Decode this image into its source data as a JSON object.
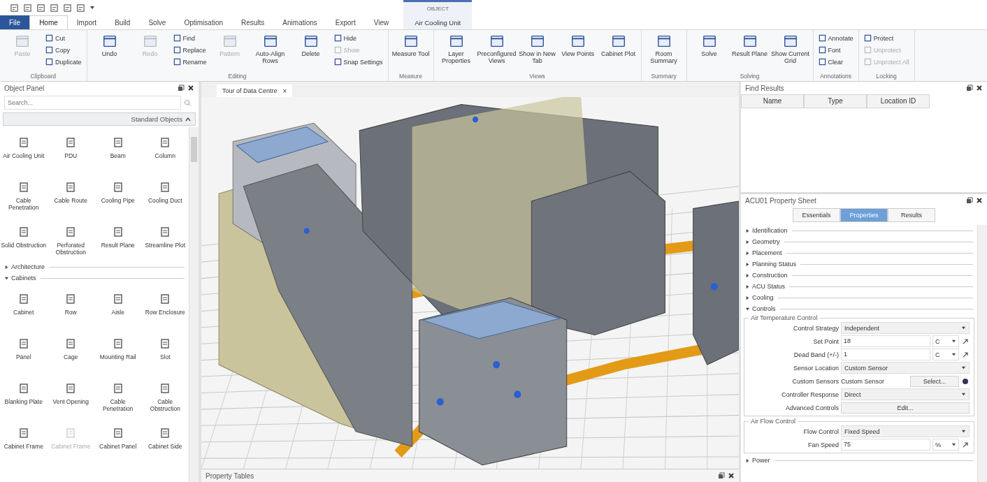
{
  "tabs": [
    {
      "label": "File",
      "kind": "file",
      "selected": false
    },
    {
      "label": "Home",
      "kind": "tab",
      "selected": true
    },
    {
      "label": "Import",
      "kind": "tab",
      "selected": false
    },
    {
      "label": "Build",
      "kind": "tab",
      "selected": false
    },
    {
      "label": "Solve",
      "kind": "tab",
      "selected": false
    },
    {
      "label": "Optimisation",
      "kind": "tab",
      "selected": false
    },
    {
      "label": "Results",
      "kind": "tab",
      "selected": false
    },
    {
      "label": "Animations",
      "kind": "tab",
      "selected": false
    },
    {
      "label": "Export",
      "kind": "tab",
      "selected": false
    },
    {
      "label": "View",
      "kind": "tab",
      "selected": false
    }
  ],
  "context_tab": {
    "group": "OBJECT",
    "label": "Air Cooling Unit",
    "selected": false
  },
  "ribbon": {
    "groups": [
      {
        "label": "Clipboard",
        "tools": [
          {
            "label": "Paste",
            "kind": "large",
            "disabled": true
          },
          {
            "label": "Cut",
            "kind": "small",
            "disabled": false
          },
          {
            "label": "Copy",
            "kind": "small",
            "disabled": false
          },
          {
            "label": "Duplicate",
            "kind": "small",
            "disabled": false
          }
        ]
      },
      {
        "label": "Editing",
        "tools": [
          {
            "label": "Undo",
            "kind": "large",
            "disabled": false
          },
          {
            "label": "Redo",
            "kind": "large",
            "disabled": true
          },
          {
            "label": "Find",
            "kind": "small",
            "disabled": false
          },
          {
            "label": "Replace",
            "kind": "small",
            "disabled": false
          },
          {
            "label": "Rename",
            "kind": "small",
            "disabled": false
          },
          {
            "label": "Pattern",
            "kind": "large",
            "disabled": true
          },
          {
            "label": "Auto-Align Rows",
            "kind": "large",
            "disabled": false
          },
          {
            "label": "Delete",
            "kind": "large",
            "disabled": false
          },
          {
            "label": "Hide",
            "kind": "small",
            "disabled": false
          },
          {
            "label": "Show",
            "kind": "small",
            "disabled": true
          },
          {
            "label": "Snap Settings",
            "kind": "small",
            "disabled": false
          }
        ]
      },
      {
        "label": "Measure",
        "tools": [
          {
            "label": "Measure Tool",
            "kind": "large",
            "disabled": false
          }
        ]
      },
      {
        "label": "Views",
        "tools": [
          {
            "label": "Layer Properties",
            "kind": "large",
            "disabled": false
          },
          {
            "label": "Preconfigured Views",
            "kind": "large",
            "disabled": false
          },
          {
            "label": "Show in New Tab",
            "kind": "large",
            "disabled": false
          },
          {
            "label": "View Points",
            "kind": "large",
            "disabled": false
          },
          {
            "label": "Cabinet Plot",
            "kind": "large",
            "disabled": false
          }
        ]
      },
      {
        "label": "Summary",
        "tools": [
          {
            "label": "Room Summary",
            "kind": "large",
            "disabled": false
          }
        ]
      },
      {
        "label": "Solving",
        "tools": [
          {
            "label": "Solve",
            "kind": "large",
            "disabled": false
          },
          {
            "label": "Result Plane",
            "kind": "large",
            "disabled": false
          },
          {
            "label": "Show Current Grid",
            "kind": "large",
            "disabled": false
          }
        ]
      },
      {
        "label": "Annotations",
        "tools": [
          {
            "label": "Annotate",
            "kind": "small",
            "disabled": false
          },
          {
            "label": "Font",
            "kind": "small",
            "disabled": false
          },
          {
            "label": "Clear",
            "kind": "small",
            "disabled": false
          }
        ]
      },
      {
        "label": "Locking",
        "tools": [
          {
            "label": "Protect",
            "kind": "small",
            "disabled": false
          },
          {
            "label": "Unprotect",
            "kind": "small",
            "disabled": true
          },
          {
            "label": "Unprotect All",
            "kind": "small",
            "disabled": true
          }
        ]
      }
    ]
  },
  "object_panel": {
    "title": "Object Panel",
    "search": {
      "placeholder": "Search..."
    },
    "library": "Standard Objects",
    "items": [
      {
        "label": "Air Cooling Unit",
        "disabled": false
      },
      {
        "label": "PDU",
        "disabled": false
      },
      {
        "label": "Beam",
        "disabled": false
      },
      {
        "label": "Column",
        "disabled": false
      },
      {
        "label": "Cable Penetration",
        "disabled": false
      },
      {
        "label": "Cable Route",
        "disabled": false
      },
      {
        "label": "Cooling Pipe",
        "disabled": false
      },
      {
        "label": "Cooling Duct",
        "disabled": false
      },
      {
        "label": "Solid Obstruction",
        "disabled": false
      },
      {
        "label": "Perforated Obstruction",
        "disabled": false
      },
      {
        "label": "Result Plane",
        "disabled": false
      },
      {
        "label": "Streamline Plot",
        "disabled": false
      }
    ],
    "sections": [
      {
        "label": "Architecture",
        "expanded": false
      },
      {
        "label": "Cabinets",
        "expanded": true,
        "items": [
          {
            "label": "Cabinet",
            "disabled": false
          },
          {
            "label": "Row",
            "disabled": false
          },
          {
            "label": "Aisle",
            "disabled": false
          },
          {
            "label": "Row Enclosure",
            "disabled": false
          },
          {
            "label": "Panel",
            "disabled": false
          },
          {
            "label": "Cage",
            "disabled": false
          },
          {
            "label": "Mounting Rail",
            "disabled": false
          },
          {
            "label": "Slot",
            "disabled": false
          },
          {
            "label": "Blanking Plate",
            "disabled": false
          },
          {
            "label": "Vent Opening",
            "disabled": false
          },
          {
            "label": "Cable Penetration",
            "disabled": false
          },
          {
            "label": "Cable Obstruction",
            "disabled": false
          },
          {
            "label": "Cabinet Frame",
            "disabled": false
          },
          {
            "label": "Cabinet Frame",
            "disabled": true
          },
          {
            "label": "Cabinet Panel",
            "disabled": false
          },
          {
            "label": "Cabinet Side",
            "disabled": false
          }
        ]
      }
    ]
  },
  "viewport": {
    "tab": "Tour of Data Centre",
    "close": "×"
  },
  "bottom_panel": {
    "title": "Property Tables"
  },
  "find_results": {
    "title": "Find Results",
    "columns": [
      "Name",
      "Type",
      "Location ID"
    ]
  },
  "property_sheet": {
    "title": "ACU01 Property Sheet",
    "tabs": [
      {
        "label": "Essentials",
        "selected": false
      },
      {
        "label": "Properties",
        "selected": true
      },
      {
        "label": "Results",
        "selected": false
      }
    ],
    "sections": [
      {
        "label": "Identification",
        "expanded": false
      },
      {
        "label": "Geometry",
        "expanded": false
      },
      {
        "label": "Placement",
        "expanded": false
      },
      {
        "label": "Planning Status",
        "expanded": false
      },
      {
        "label": "Construction",
        "expanded": false
      },
      {
        "label": "ACU Status",
        "expanded": false
      },
      {
        "label": "Cooling",
        "expanded": false
      },
      {
        "label": "Controls",
        "expanded": true,
        "groups": [
          {
            "title": "Air Temperature Control",
            "rows": [
              {
                "label": "Control Strategy",
                "kind": "dropdown",
                "value": "Independent"
              },
              {
                "label": "Set Point",
                "kind": "number",
                "value": "18",
                "unit": "C"
              },
              {
                "label": "Dead Band (+/-)",
                "kind": "number",
                "value": "1",
                "unit": "C"
              },
              {
                "label": "Sensor Location",
                "kind": "dropdown",
                "value": "Custom Sensor"
              },
              {
                "label": "Custom Sensors",
                "kind": "select",
                "value": "Custom Sensor",
                "button": "Select..."
              },
              {
                "label": "Controller Response",
                "kind": "dropdown",
                "value": "Direct"
              },
              {
                "label": "Advanced Controls",
                "kind": "button",
                "button": "Edit..."
              }
            ]
          },
          {
            "title": "Air Flow Control",
            "rows": [
              {
                "label": "Flow Control",
                "kind": "dropdown",
                "value": "Fixed Speed"
              },
              {
                "label": "Fan Speed",
                "kind": "number",
                "value": "75",
                "unit": "%"
              }
            ]
          }
        ]
      },
      {
        "label": "Power",
        "expanded": false
      }
    ]
  }
}
